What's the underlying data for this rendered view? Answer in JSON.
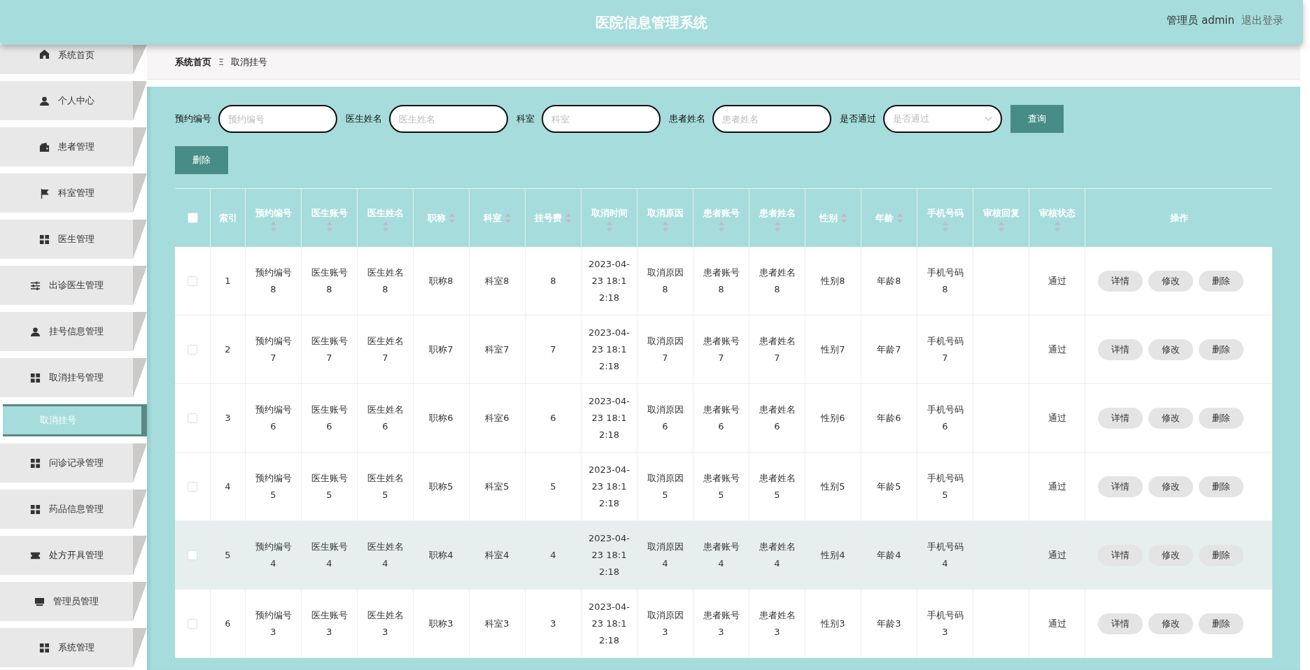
{
  "header": {
    "title": "医院信息管理系统",
    "user": "管理员 admin",
    "logout": "退出登录"
  },
  "sidebar": {
    "items": [
      {
        "label": "系统首页",
        "selected": false
      },
      {
        "label": "个人中心",
        "selected": false
      },
      {
        "label": "患者管理",
        "selected": false
      },
      {
        "label": "科室管理",
        "selected": false
      },
      {
        "label": "医生管理",
        "selected": false
      },
      {
        "label": "出诊医生管理",
        "selected": false
      },
      {
        "label": "挂号信息管理",
        "selected": false
      },
      {
        "label": "取消挂号管理",
        "selected": false,
        "children": [
          {
            "label": "取消挂号",
            "selected": true
          }
        ]
      },
      {
        "label": "问诊记录管理",
        "selected": false
      },
      {
        "label": "药品信息管理",
        "selected": false
      },
      {
        "label": "处方开具管理",
        "selected": false
      },
      {
        "label": "管理员管理",
        "selected": false
      },
      {
        "label": "系统管理",
        "selected": false
      }
    ]
  },
  "breadcrumb": {
    "home": "系统首页",
    "separator": "Ξ",
    "current": "取消挂号"
  },
  "search": {
    "fields": [
      {
        "kind": "input",
        "label": "预约编号",
        "placeholder": "预约编号"
      },
      {
        "kind": "input",
        "label": "医生姓名",
        "placeholder": "医生姓名"
      },
      {
        "kind": "input",
        "label": "科室",
        "placeholder": "科室"
      },
      {
        "kind": "input",
        "label": "患者姓名",
        "placeholder": "患者姓名"
      },
      {
        "kind": "select",
        "label": "是否通过",
        "placeholder": "是否通过"
      }
    ],
    "query_button": "查询",
    "delete_button": "删除"
  },
  "table": {
    "select_all_checked": false,
    "columns": [
      {
        "label": "索引",
        "sortable": false
      },
      {
        "label": "预约编号",
        "sortable": true
      },
      {
        "label": "医生账号",
        "sortable": true
      },
      {
        "label": "医生姓名",
        "sortable": true
      },
      {
        "label": "职称",
        "sortable": true
      },
      {
        "label": "科室",
        "sortable": true
      },
      {
        "label": "挂号费",
        "sortable": true
      },
      {
        "label": "取消时间",
        "sortable": true
      },
      {
        "label": "取消原因",
        "sortable": true
      },
      {
        "label": "患者账号",
        "sortable": true
      },
      {
        "label": "患者姓名",
        "sortable": true
      },
      {
        "label": "性别",
        "sortable": true
      },
      {
        "label": "年龄",
        "sortable": true
      },
      {
        "label": "手机号码",
        "sortable": true
      },
      {
        "label": "审核回复",
        "sortable": true
      },
      {
        "label": "审核状态",
        "sortable": true
      },
      {
        "label": "操作",
        "sortable": false
      }
    ],
    "rows": [
      {
        "checked": false,
        "hovered": false,
        "cells": [
          "1",
          "预约编号8",
          "医生账号8",
          "医生姓名8",
          "职称8",
          "科室8",
          "8",
          "2023-04-23 18:12:18",
          "取消原因8",
          "患者账号8",
          "患者姓名8",
          "性别8",
          "年龄8",
          "手机号码8",
          null,
          "通过"
        ],
        "actions": [
          "详情",
          "修改",
          "删除"
        ]
      },
      {
        "checked": false,
        "hovered": false,
        "cells": [
          "2",
          "预约编号7",
          "医生账号7",
          "医生姓名7",
          "职称7",
          "科室7",
          "7",
          "2023-04-23 18:12:18",
          "取消原因7",
          "患者账号7",
          "患者姓名7",
          "性别7",
          "年龄7",
          "手机号码7",
          null,
          "通过"
        ],
        "actions": [
          "详情",
          "修改",
          "删除"
        ]
      },
      {
        "checked": false,
        "hovered": false,
        "cells": [
          "3",
          "预约编号6",
          "医生账号6",
          "医生姓名6",
          "职称6",
          "科室6",
          "6",
          "2023-04-23 18:12:18",
          "取消原因6",
          "患者账号6",
          "患者姓名6",
          "性别6",
          "年龄6",
          "手机号码6",
          null,
          "通过"
        ],
        "actions": [
          "详情",
          "修改",
          "删除"
        ]
      },
      {
        "checked": false,
        "hovered": false,
        "cells": [
          "4",
          "预约编号5",
          "医生账号5",
          "医生姓名5",
          "职称5",
          "科室5",
          "5",
          "2023-04-23 18:12:18",
          "取消原因5",
          "患者账号5",
          "患者姓名5",
          "性别5",
          "年龄5",
          "手机号码5",
          null,
          "通过"
        ],
        "actions": [
          "详情",
          "修改",
          "删除"
        ]
      },
      {
        "checked": false,
        "hovered": true,
        "cells": [
          "5",
          "预约编号4",
          "医生账号4",
          "医生姓名4",
          "职称4",
          "科室4",
          "4",
          "2023-04-23 18:12:18",
          "取消原因4",
          "患者账号4",
          "患者姓名4",
          "性别4",
          "年龄4",
          "手机号码4",
          null,
          "通过"
        ],
        "actions": [
          "详情",
          "修改",
          "删除"
        ]
      },
      {
        "checked": false,
        "hovered": false,
        "cells": [
          "6",
          "预约编号3",
          "医生账号3",
          "医生姓名3",
          "职称3",
          "科室3",
          "3",
          "2023-04-23 18:12:18",
          "取消原因3",
          "患者账号3",
          "患者姓名3",
          "性别3",
          "年龄3",
          "手机号码3",
          null,
          "通过"
        ],
        "actions": [
          "详情",
          "修改",
          "删除"
        ]
      }
    ]
  }
}
